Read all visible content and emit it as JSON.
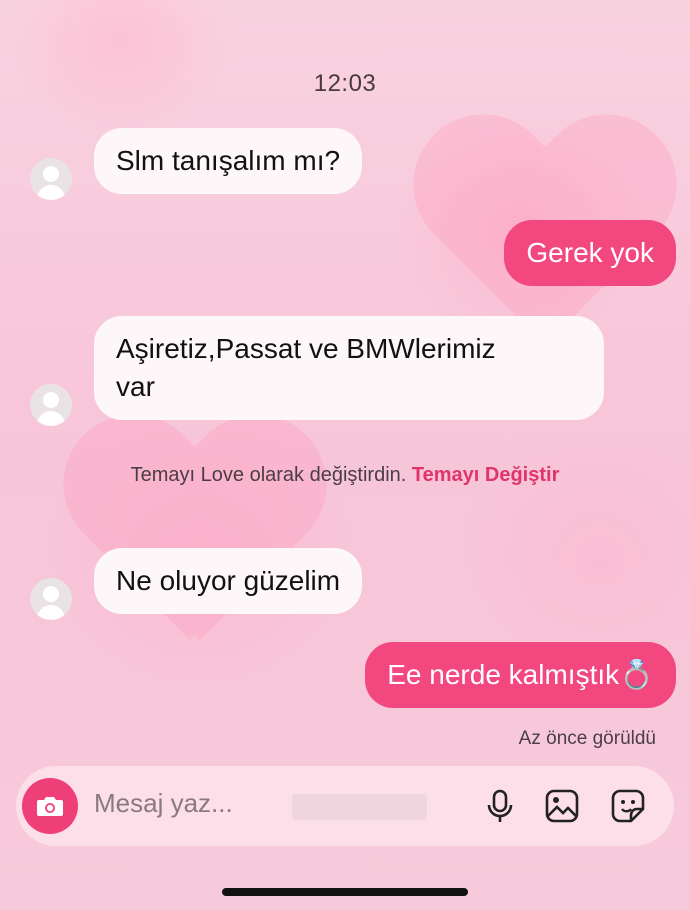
{
  "status": {
    "time": "12:03"
  },
  "messages": [
    {
      "from": "them",
      "text": "Slm tanışalım mı?"
    },
    {
      "from": "me",
      "text": "Gerek yok"
    },
    {
      "from": "them",
      "line1": "Aşiretiz,Passat ve BMWlerimiz",
      "line2": "var"
    },
    {
      "from": "them",
      "text": "Ne oluyor güzelim"
    },
    {
      "from": "me",
      "text": "Ee nerde kalmıştık💍"
    }
  ],
  "system_notice": {
    "text": "Temayı Love olarak değiştirdin. ",
    "link_label": "Temayı Değiştir"
  },
  "read_receipt": "Az önce görüldü",
  "composer": {
    "placeholder": "Mesaj yaz...",
    "icons": [
      "camera-icon",
      "microphone-icon",
      "gallery-icon",
      "sticker-icon"
    ]
  },
  "colors": {
    "accent": "#f3487f",
    "background": "#f7c9da",
    "incoming_bubble": "#fdf7f9"
  }
}
